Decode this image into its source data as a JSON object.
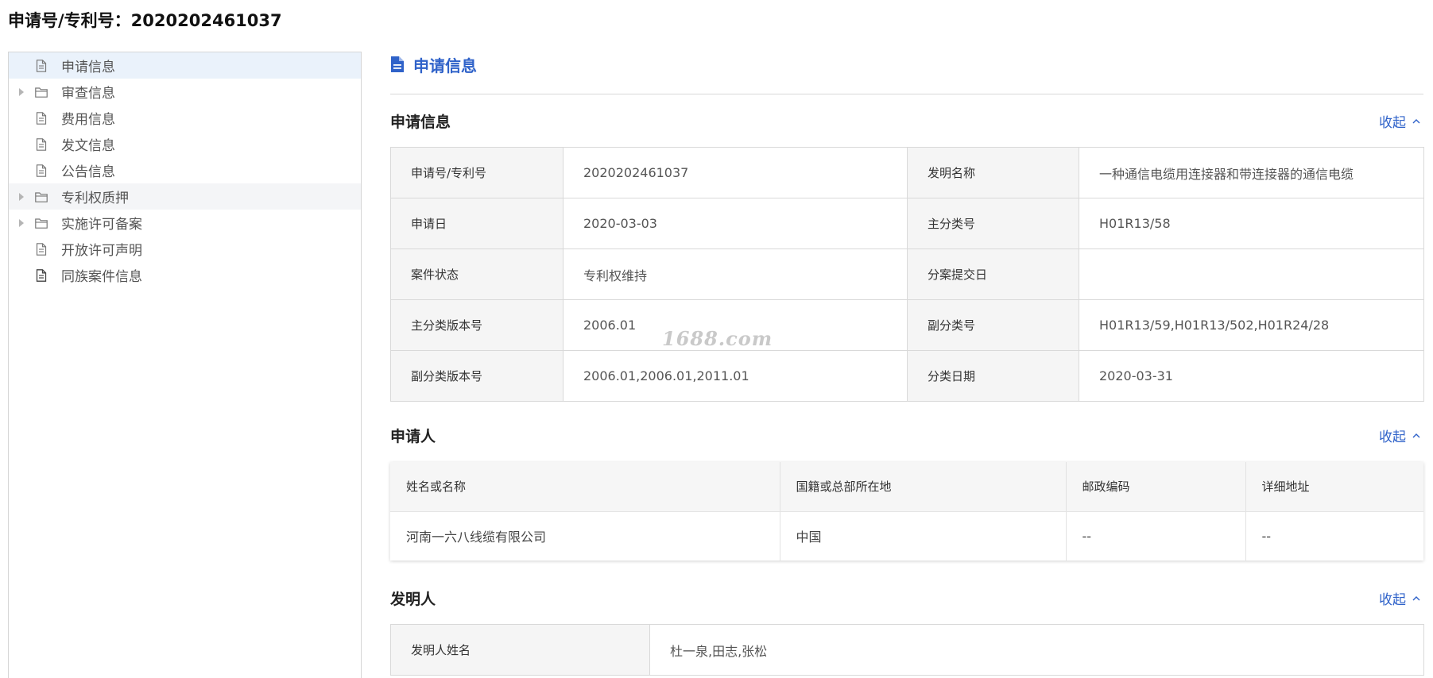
{
  "header": {
    "title": "申请号/专利号：2020202461037"
  },
  "sidebar": {
    "items": [
      {
        "label": "申请信息",
        "icon": "document-icon",
        "expandable": false
      },
      {
        "label": "审查信息",
        "icon": "folder-icon",
        "expandable": true
      },
      {
        "label": "费用信息",
        "icon": "document-icon",
        "expandable": false
      },
      {
        "label": "发文信息",
        "icon": "document-icon",
        "expandable": false
      },
      {
        "label": "公告信息",
        "icon": "document-icon",
        "expandable": false
      },
      {
        "label": "专利权质押",
        "icon": "folder-icon",
        "expandable": true
      },
      {
        "label": "实施许可备案",
        "icon": "folder-icon",
        "expandable": true
      },
      {
        "label": "开放许可声明",
        "icon": "document-icon",
        "expandable": false
      },
      {
        "label": "同族案件信息",
        "icon": "document-icon",
        "expandable": false
      }
    ]
  },
  "main": {
    "title": "申请信息",
    "collapse_label": "收起",
    "application_section": {
      "title": "申请信息",
      "rows": [
        {
          "label1": "申请号/专利号",
          "value1": "2020202461037",
          "label2": "发明名称",
          "value2": "一种通信电缆用连接器和带连接器的通信电缆"
        },
        {
          "label1": "申请日",
          "value1": "2020-03-03",
          "label2": "主分类号",
          "value2": "H01R13/58"
        },
        {
          "label1": "案件状态",
          "value1": "专利权维持",
          "label2": "分案提交日",
          "value2": ""
        },
        {
          "label1": "主分类版本号",
          "value1": "2006.01",
          "label2": "副分类号",
          "value2": "H01R13/59,H01R13/502,H01R24/28"
        },
        {
          "label1": "副分类版本号",
          "value1": "2006.01,2006.01,2011.01",
          "label2": "分类日期",
          "value2": "2020-03-31"
        }
      ]
    },
    "applicant_section": {
      "title": "申请人",
      "columns": [
        "姓名或名称",
        "国籍或总部所在地",
        "邮政编码",
        "详细地址"
      ],
      "rows": [
        [
          "河南一六八线缆有限公司",
          "中国",
          "--",
          "--"
        ]
      ]
    },
    "inventor_section": {
      "title": "发明人",
      "label": "发明人姓名",
      "value": "杜一泉,田志,张松"
    }
  },
  "watermark": {
    "text": "1688.com"
  },
  "colors": {
    "accent": "#2f62c9",
    "active_row": "#eaf2fb"
  }
}
